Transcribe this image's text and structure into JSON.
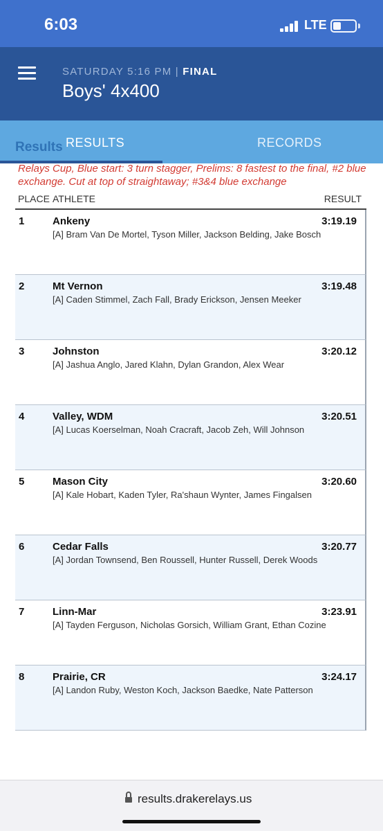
{
  "status_bar": {
    "time": "6:03",
    "network": "LTE",
    "battery_level": 0.35
  },
  "header": {
    "day_time": "SATURDAY 5:16 PM",
    "separator": "|",
    "status": "FINAL",
    "title": "Boys' 4x400",
    "menu_icon": "hamburger-menu-icon"
  },
  "tabs": {
    "ghost_label": "Results",
    "items": [
      {
        "label": "RESULTS",
        "active": true
      },
      {
        "label": "RECORDS",
        "active": false
      }
    ]
  },
  "note": "Relays Cup, Blue start: 3 turn stagger, Prelims: 8 fastest to the final, #2 blue exchange. Cut at top of straightaway; #3&4 blue exchange",
  "columns": {
    "place": "PLACE",
    "athlete": "ATHLETE",
    "result": "RESULT"
  },
  "results": [
    {
      "place": "1",
      "team": "Ankeny",
      "athletes": "[A] Bram Van De Mortel, Tyson Miller, Jackson Belding, Jake Bosch",
      "time": "3:19.19"
    },
    {
      "place": "2",
      "team": "Mt Vernon",
      "athletes": "[A] Caden Stimmel, Zach Fall, Brady Erickson, Jensen Meeker",
      "time": "3:19.48"
    },
    {
      "place": "3",
      "team": "Johnston",
      "athletes": "[A] Jashua Anglo, Jared Klahn, Dylan Grandon, Alex Wear",
      "time": "3:20.12"
    },
    {
      "place": "4",
      "team": "Valley, WDM",
      "athletes": "[A] Lucas Koerselman, Noah Cracraft, Jacob Zeh, Will Johnson",
      "time": "3:20.51"
    },
    {
      "place": "5",
      "team": "Mason City",
      "athletes": "[A] Kale Hobart, Kaden Tyler, Ra'shaun Wynter, James Fingalsen",
      "time": "3:20.60"
    },
    {
      "place": "6",
      "team": "Cedar Falls",
      "athletes": "[A] Jordan Townsend, Ben Roussell, Hunter Russell, Derek Woods",
      "time": "3:20.77"
    },
    {
      "place": "7",
      "team": "Linn-Mar",
      "athletes": "[A] Tayden Ferguson, Nicholas Gorsich, William Grant, Ethan Cozine",
      "time": "3:23.91"
    },
    {
      "place": "8",
      "team": "Prairie, CR",
      "athletes": "[A] Landon Ruby, Weston Koch, Jackson Baedke, Nate Patterson",
      "time": "3:24.17"
    }
  ],
  "browser": {
    "url": "results.drakerelays.us",
    "lock_icon": "lock-icon"
  },
  "colors": {
    "status_bar": "#3f71cc",
    "header": "#2a5597",
    "tabs": "#5ea8e0",
    "note": "#d23a32",
    "row_alt": "#eef5fc"
  }
}
